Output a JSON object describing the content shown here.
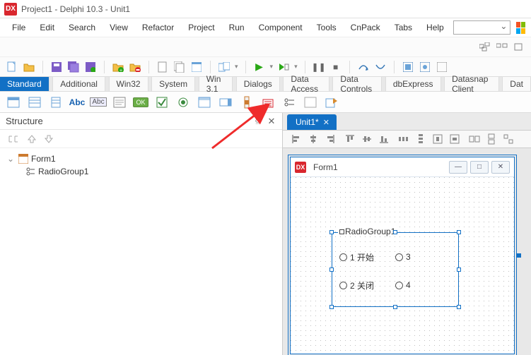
{
  "app": {
    "title": "Project1 - Delphi 10.3 - Unit1"
  },
  "menu": {
    "items": [
      "File",
      "Edit",
      "Search",
      "View",
      "Refactor",
      "Project",
      "Run",
      "Component",
      "Tools",
      "CnPack",
      "Tabs",
      "Help"
    ]
  },
  "component_tabs": {
    "items": [
      "Standard",
      "Additional",
      "Win32",
      "System",
      "Win 3.1",
      "Dialogs",
      "Data Access",
      "Data Controls",
      "dbExpress",
      "Datasnap Client",
      "Dat"
    ],
    "active_index": 0
  },
  "structure": {
    "title": "Structure",
    "root": {
      "label": "Form1"
    },
    "child": {
      "label": "RadioGroup1"
    }
  },
  "document": {
    "tab_label": "Unit1*"
  },
  "form": {
    "title": "Form1",
    "radiogroup": {
      "caption": "RadioGroup1",
      "options": [
        "1 开始",
        "3",
        "2 关闭",
        "4"
      ]
    },
    "window_buttons": {
      "min": "—",
      "max": "□",
      "close": "✕"
    }
  },
  "icons": {
    "pin": "⫃",
    "close": "✕"
  }
}
